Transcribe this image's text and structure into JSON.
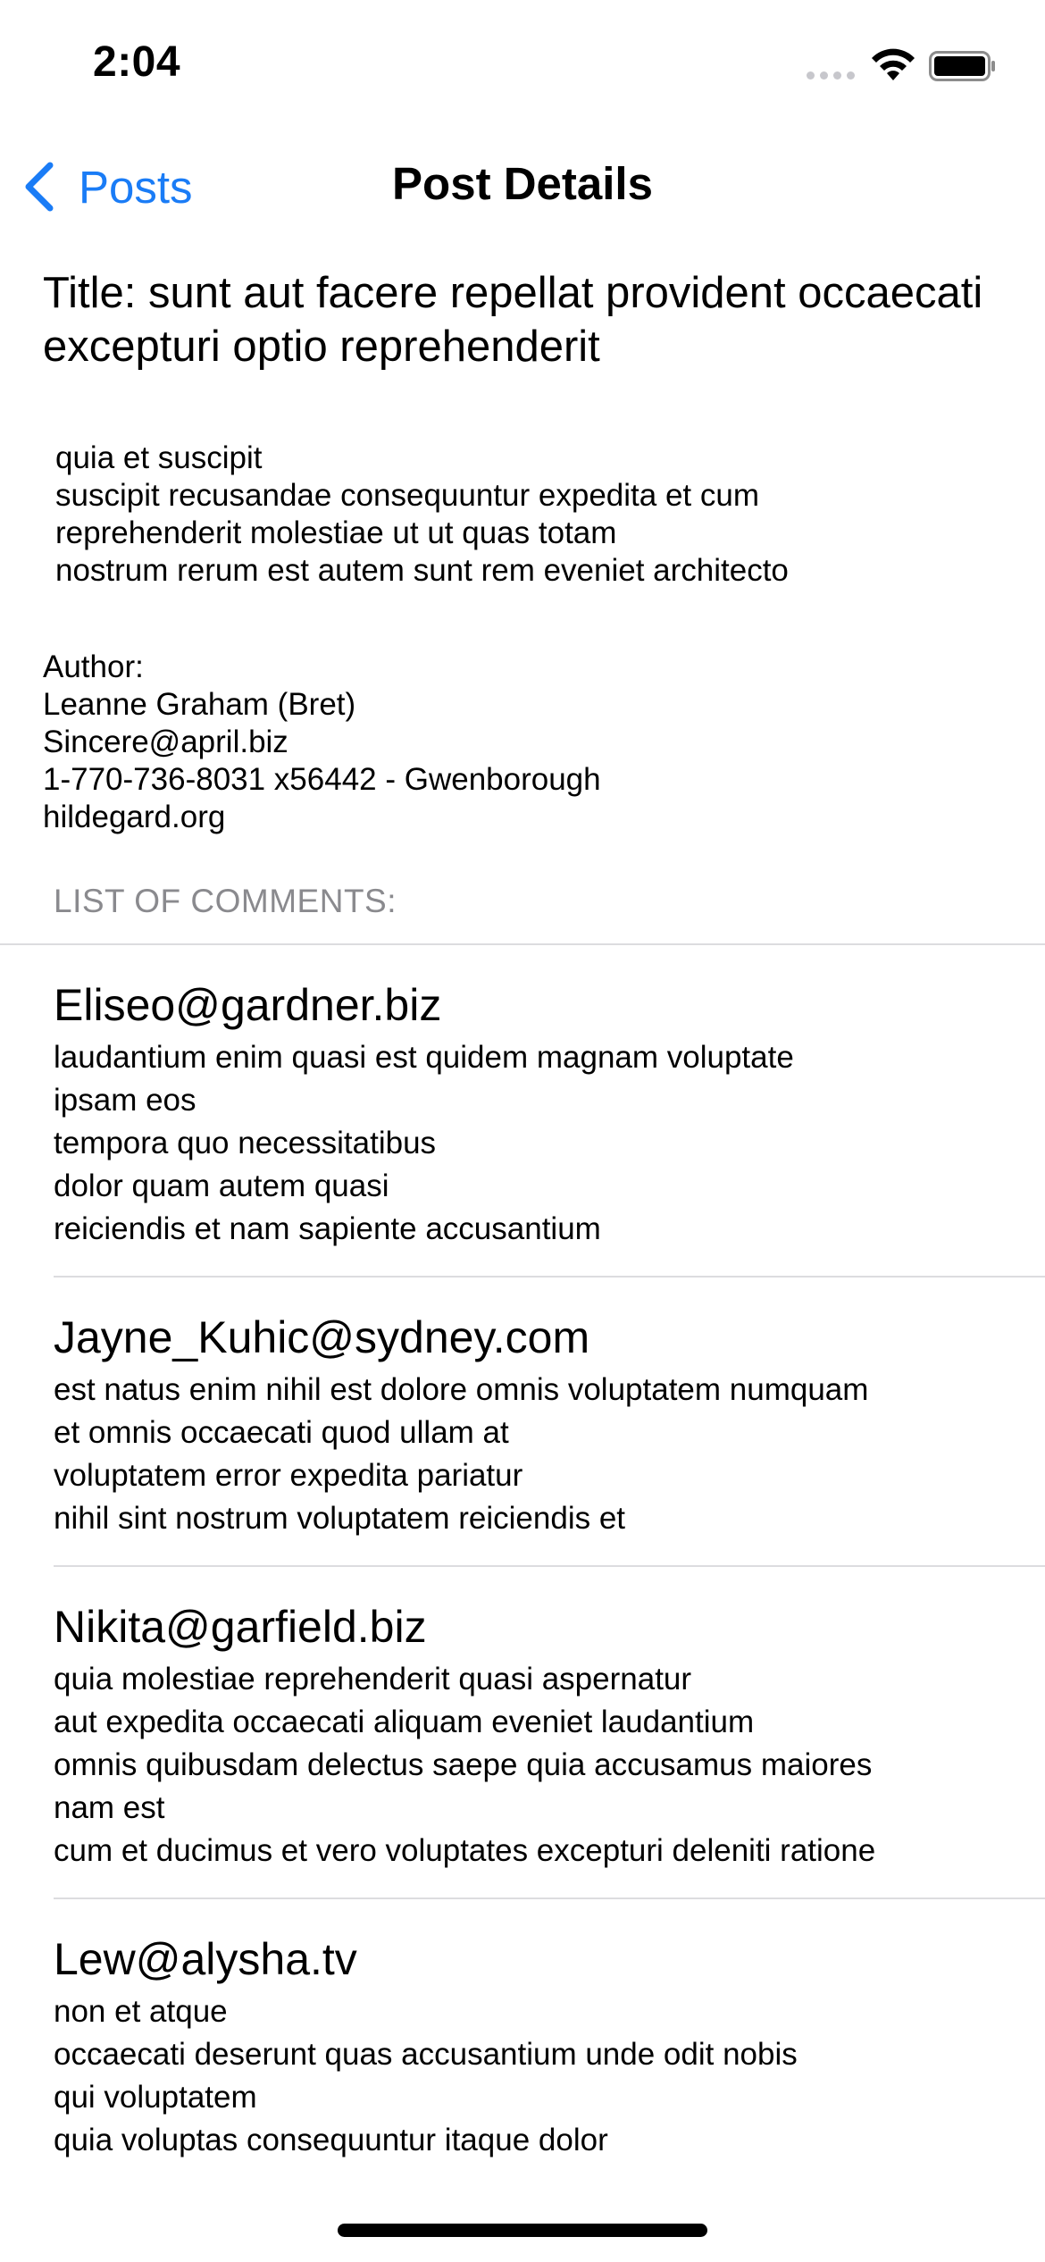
{
  "status_bar": {
    "time": "2:04"
  },
  "nav": {
    "back_label": "Posts",
    "title": "Post Details",
    "accent_color": "#1a7cf6"
  },
  "post": {
    "title": "Title: sunt aut facere repellat provident occaecati excepturi optio reprehenderit",
    "body": "quia et suscipit\nsuscipit recusandae consequuntur expedita et cum\nreprehenderit molestiae ut ut quas totam\nnostrum rerum est autem sunt rem eveniet architecto",
    "author_label": "Author:",
    "author_name": "Leanne Graham (Bret)",
    "author_email": "Sincere@april.biz",
    "author_phone_city": "1-770-736-8031 x56442 - Gwenborough",
    "author_website": "hildegard.org"
  },
  "comments": {
    "header": "LIST OF COMMENTS:",
    "items": [
      {
        "email": "Eliseo@gardner.biz",
        "body": "laudantium enim quasi est quidem magnam voluptate\nipsam eos\ntempora quo necessitatibus\ndolor quam autem quasi\nreiciendis et nam sapiente accusantium"
      },
      {
        "email": "Jayne_Kuhic@sydney.com",
        "body": "est natus enim nihil est dolore omnis voluptatem numquam\net omnis occaecati quod ullam at\nvoluptatem error expedita pariatur\nnihil sint nostrum voluptatem reiciendis et"
      },
      {
        "email": "Nikita@garfield.biz",
        "body": "quia molestiae reprehenderit quasi aspernatur\naut expedita occaecati aliquam eveniet laudantium\nomnis quibusdam delectus saepe quia accusamus maiores\nnam est\ncum et ducimus et vero voluptates excepturi deleniti ratione"
      },
      {
        "email": "Lew@alysha.tv",
        "body": "non et atque\noccaecati deserunt quas accusantium unde odit nobis\nqui voluptatem\nquia voluptas consequuntur itaque dolor"
      }
    ]
  }
}
